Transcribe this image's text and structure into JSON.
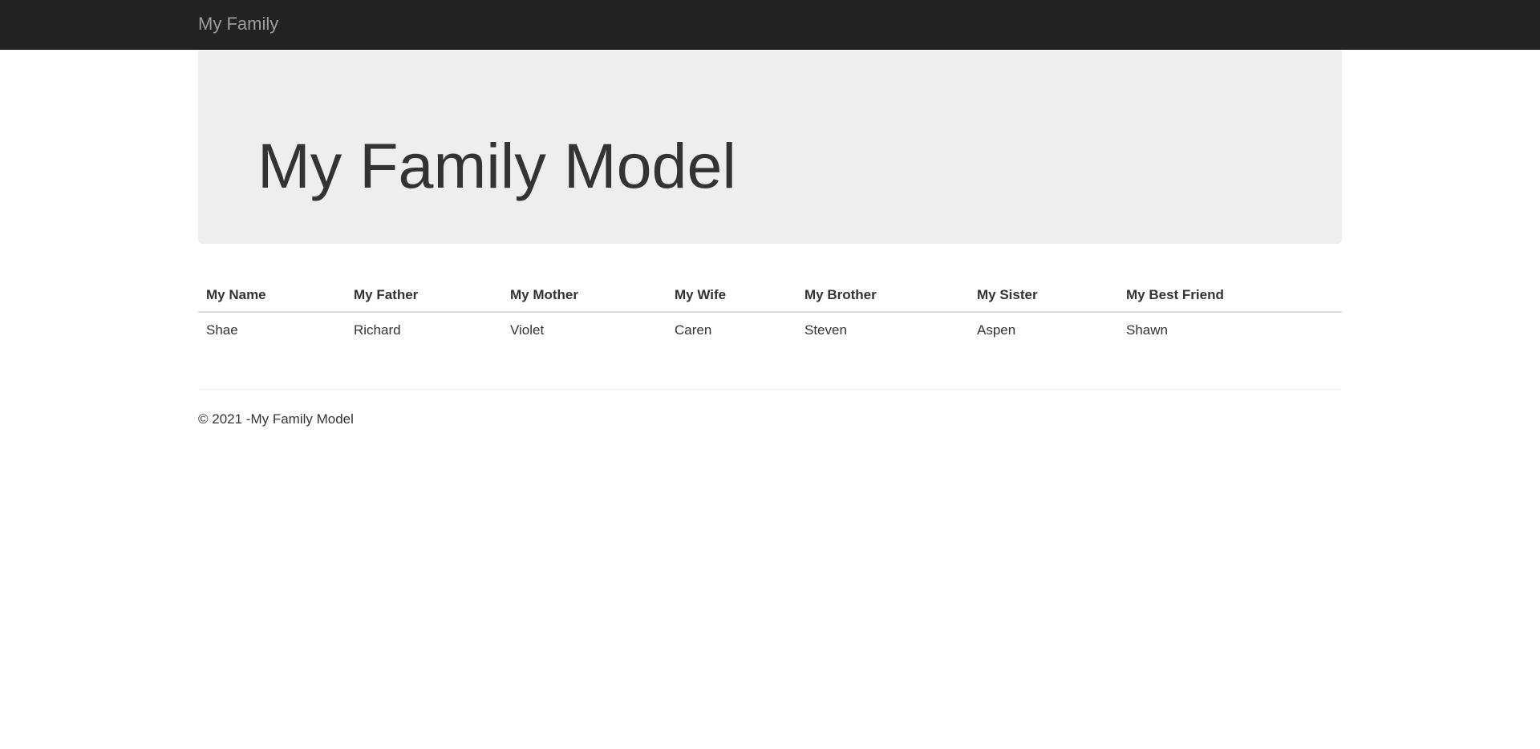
{
  "navbar": {
    "brand": "My Family"
  },
  "jumbotron": {
    "title": "My Family Model"
  },
  "table": {
    "headers": [
      "My Name",
      "My Father",
      "My Mother",
      "My Wife",
      "My Brother",
      "My Sister",
      "My Best Friend"
    ],
    "rows": [
      [
        "Shae",
        "Richard",
        "Violet",
        "Caren",
        "Steven",
        "Aspen",
        "Shawn"
      ]
    ]
  },
  "footer": {
    "text": "© 2021 -My Family Model"
  },
  "colors": {
    "navbar_bg": "#222222",
    "brand_text": "#9d9d9d",
    "jumbotron_bg": "#eeeeee",
    "text": "#333333"
  }
}
